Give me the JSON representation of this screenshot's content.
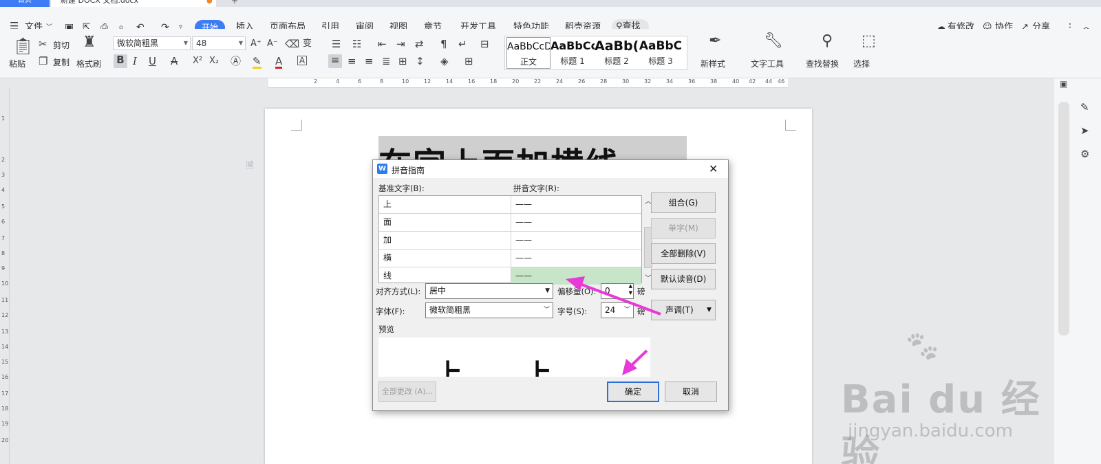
{
  "tabs": {
    "home": "首页",
    "doc": "新建 DOCX 文档.docx",
    "add": "+"
  },
  "menu": {
    "file": "文件",
    "items": [
      "开始",
      "插入",
      "页面布局",
      "引用",
      "审阅",
      "视图",
      "章节",
      "开发工具",
      "特色功能",
      "稻壳资源"
    ],
    "search": "查找",
    "right": {
      "modified": "有修改",
      "collab": "协作",
      "share": "分享"
    }
  },
  "ribbon": {
    "paste": "粘贴",
    "cut": "剪切",
    "copy": "复制",
    "format_painter": "格式刷",
    "font_name": "微软简粗黑",
    "font_size": "48",
    "styles": [
      {
        "preview": "AaBbCcD",
        "name": "正文"
      },
      {
        "preview": "AaBbCc",
        "name": "标题 1"
      },
      {
        "preview": "AaBb(",
        "name": "标题 2"
      },
      {
        "preview": "AaBbC",
        "name": "标题 3"
      }
    ],
    "new_style": "新样式",
    "text_tools": "文字工具",
    "find_replace": "查找替换",
    "select": "选择"
  },
  "ruler": {
    "h_ticks": [
      "2",
      "4",
      "6",
      "8",
      "10",
      "12",
      "14",
      "16",
      "18",
      "20",
      "22",
      "24",
      "26",
      "28",
      "30",
      "32",
      "34",
      "36",
      "38",
      "40",
      "42",
      "44",
      "46"
    ],
    "v_ticks": [
      "1",
      "2",
      "3",
      "4",
      "5",
      "6",
      "7",
      "8",
      "9",
      "10",
      "11",
      "12",
      "13",
      "14",
      "15",
      "16",
      "17",
      "18",
      "19",
      "20"
    ]
  },
  "document": {
    "heading_text": "在字上面加横线"
  },
  "dialog": {
    "title": "拼音指南",
    "base_label": "基准文字(B):",
    "ruby_label": "拼音文字(R):",
    "rows": [
      {
        "base": "上",
        "ruby": "——"
      },
      {
        "base": "面",
        "ruby": "——"
      },
      {
        "base": "加",
        "ruby": "——"
      },
      {
        "base": "横",
        "ruby": "——"
      },
      {
        "base": "线",
        "ruby": "——"
      }
    ],
    "align_label": "对齐方式(L):",
    "align_value": "居中",
    "offset_label": "偏移量(O):",
    "offset_value": "0",
    "offset_unit": "磅",
    "font_label": "字体(F):",
    "font_value": "微软简粗黑",
    "size_label": "字号(S):",
    "size_value": "24",
    "size_unit": "磅",
    "preview_label": "预览",
    "preview_chars": [
      "上",
      "上"
    ],
    "buttons": {
      "combine": "组合(G)",
      "single": "单字(M)",
      "delete_all": "全部删除(V)",
      "default_reading": "默认读音(D)",
      "tone": "声调(T)",
      "change_all": "全部更改 (A)...",
      "ok": "确定",
      "cancel": "取消"
    }
  },
  "watermark": {
    "logo": "Bai du 经验",
    "url": "jingyan.baidu.com"
  },
  "colors": {
    "accent": "#3d7cf5",
    "highlight_row": "#c7e5c9",
    "arrow": "#e83ad8"
  }
}
